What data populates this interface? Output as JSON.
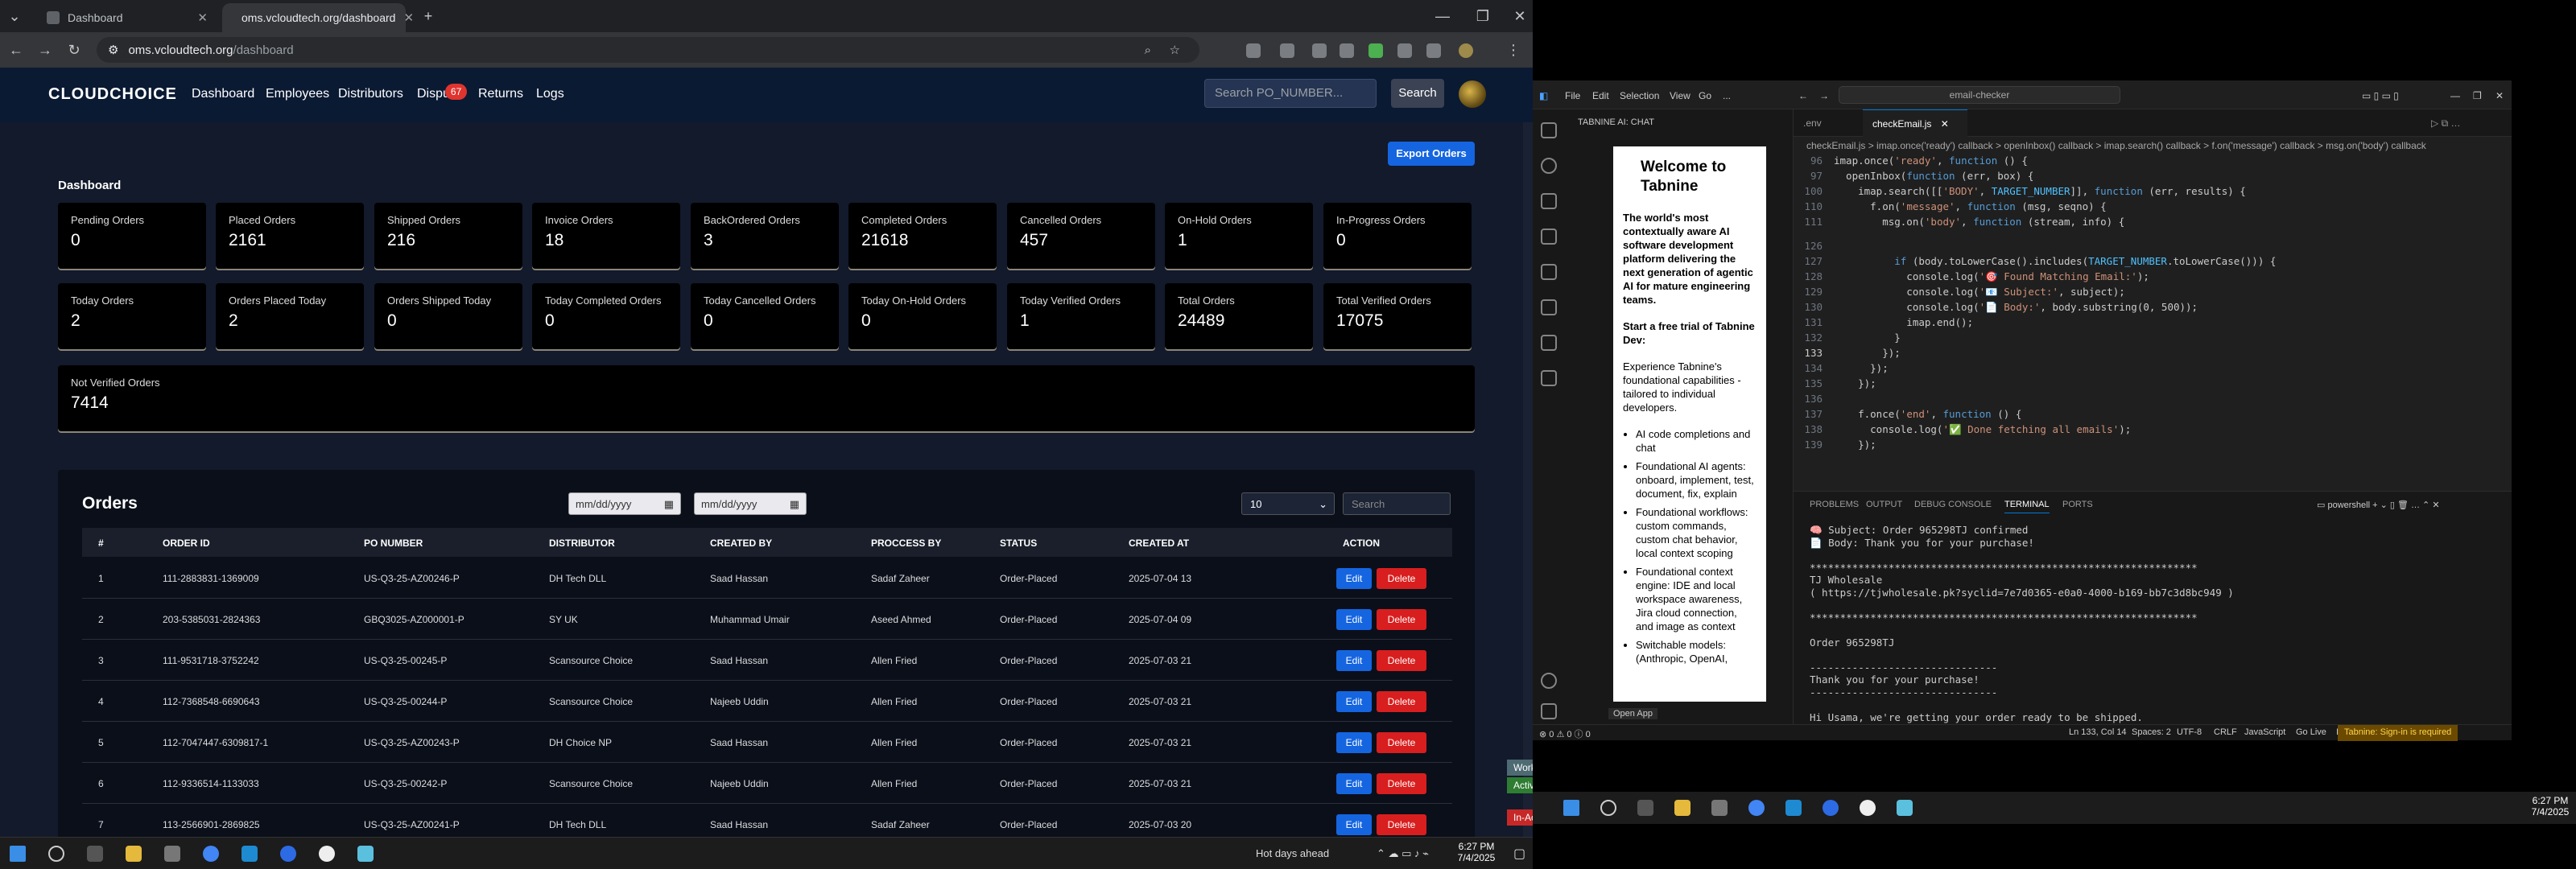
{
  "browser": {
    "tabs": [
      {
        "label": "Dashboard"
      },
      {
        "label": "oms.vcloudtech.org/dashboard"
      }
    ],
    "url_domain": "oms.vcloudtech.org",
    "url_path": "/dashboard"
  },
  "app": {
    "logo": "CLOUDCHOICE",
    "nav": [
      "Dashboard",
      "Employees",
      "Distributors",
      "Dispu",
      "Returns",
      "Logs"
    ],
    "disputes_badge": "67",
    "search_placeholder": "Search PO_NUMBER...",
    "search_button": "Search"
  },
  "dashboard": {
    "export_label": "Export Orders",
    "title": "Dashboard",
    "cards": [
      {
        "label": "Pending Orders",
        "value": "0"
      },
      {
        "label": "Placed Orders",
        "value": "2161"
      },
      {
        "label": "Shipped Orders",
        "value": "216"
      },
      {
        "label": "Invoice Orders",
        "value": "18"
      },
      {
        "label": "BackOrdered Orders",
        "value": "3"
      },
      {
        "label": "Completed Orders",
        "value": "21618"
      },
      {
        "label": "Cancelled Orders",
        "value": "457"
      },
      {
        "label": "On-Hold Orders",
        "value": "1"
      },
      {
        "label": "In-Progress Orders",
        "value": "0"
      },
      {
        "label": "Today Orders",
        "value": "2"
      },
      {
        "label": "Orders Placed Today",
        "value": "2"
      },
      {
        "label": "Orders Shipped Today",
        "value": "0"
      },
      {
        "label": "Today Completed Orders",
        "value": "0"
      },
      {
        "label": "Today Cancelled Orders",
        "value": "0"
      },
      {
        "label": "Today On-Hold Orders",
        "value": "0"
      },
      {
        "label": "Today Verified Orders",
        "value": "1"
      },
      {
        "label": "Total Orders",
        "value": "24489"
      },
      {
        "label": "Total Verified Orders",
        "value": "17075"
      },
      {
        "label": "Not Verified Orders",
        "value": "7414"
      }
    ]
  },
  "orders": {
    "title": "Orders",
    "date_placeholder": "mm/dd/yyyy",
    "page_size": "10",
    "search_placeholder": "Search",
    "columns": [
      "#",
      "ORDER ID",
      "PO NUMBER",
      "DISTRIBUTOR",
      "CREATED BY",
      "PROCCESS BY",
      "STATUS",
      "CREATED AT",
      "ACTION"
    ],
    "edit_label": "Edit",
    "delete_label": "Delete",
    "rows": [
      [
        "1",
        "111-2883831-1369009",
        "US-Q3-25-AZ00246-P",
        "DH Tech DLL",
        "Saad Hassan",
        "Sadaf Zaheer",
        "Order-Placed",
        "2025-07-04 13"
      ],
      [
        "2",
        "203-5385031-2824363",
        "GBQ3025-AZ000001-P",
        "SY UK",
        "Muhammad Umair",
        "Aseed Ahmed",
        "Order-Placed",
        "2025-07-04 09"
      ],
      [
        "3",
        "111-9531718-3752242",
        "US-Q3-25-00245-P",
        "Scansource Choice",
        "Saad Hassan",
        "Allen Fried",
        "Order-Placed",
        "2025-07-03 21"
      ],
      [
        "4",
        "112-7368548-6690643",
        "US-Q3-25-00244-P",
        "Scansource Choice",
        "Najeeb Uddin",
        "Allen Fried",
        "Order-Placed",
        "2025-07-03 21"
      ],
      [
        "5",
        "112-7047447-6309817-1",
        "US-Q3-25-AZ00243-P",
        "DH Choice NP",
        "Saad Hassan",
        "Allen Fried",
        "Order-Placed",
        "2025-07-03 21"
      ],
      [
        "6",
        "112-9336514-1133033",
        "US-Q3-25-00242-P",
        "Scansource Choice",
        "Najeeb Uddin",
        "Allen Fried",
        "Order-Placed",
        "2025-07-03 21"
      ],
      [
        "7",
        "113-2566901-2869825",
        "US-Q3-25-AZ00241-P",
        "DH Tech DLL",
        "Saad Hassan",
        "Sadaf Zaheer",
        "Order-Placed",
        "2025-07-03 20"
      ]
    ]
  },
  "taskbar": {
    "weather": "Hot days ahead",
    "time": "6:27 PM",
    "date": "7/4/2025"
  },
  "working_status": {
    "status": "Working Status: Active",
    "active": "Active",
    "inactive": "In-Acti"
  },
  "vscode": {
    "menus": [
      "File",
      "Edit",
      "Selection",
      "View",
      "Go",
      "..."
    ],
    "search": "email-checker",
    "side_header": "TABNINE AI: CHAT",
    "tabnine": {
      "title": "Welcome to Tabnine",
      "intro": "The world's most contextually aware AI software development platform delivering the next generation of agentic AI for mature engineering teams.",
      "trial": "Start a free trial of Tabnine Dev:",
      "exp": "Experience Tabnine's foundational capabilities - tailored to individual developers.",
      "bullets": [
        "AI code completions and chat",
        "Foundational AI agents: onboard, implement, test, document, fix, explain",
        "Foundational workflows: custom commands, custom chat behavior, local context scoping",
        "Foundational context engine: IDE and local workspace awareness, Jira cloud connection, and image as context",
        "Switchable models: (Anthropic, OpenAI,"
      ]
    },
    "open_app": "Open App",
    "tabs": [
      ".env",
      "checkEmail.js"
    ],
    "breadcrumb": "checkEmail.js > imap.once('ready') callback > openInbox() callback > imap.search() callback > f.on('message') callback > msg.on('body') callback",
    "code_top": [
      {
        "n": "96",
        "t": "imap.once('ready', function () {"
      },
      {
        "n": "97",
        "t": "  openInbox(function (err, box) {"
      },
      {
        "n": "100",
        "t": "    imap.search([['BODY', TARGET_NUMBER]], function (err, results) {"
      },
      {
        "n": "110",
        "t": "      f.on('message', function (msg, seqno) {"
      },
      {
        "n": "111",
        "t": "        msg.on('body', function (stream, info) {"
      }
    ],
    "code": [
      {
        "n": "126",
        "t": ""
      },
      {
        "n": "127",
        "t": "          if (body.toLowerCase().includes(TARGET_NUMBER.toLowerCase())) {"
      },
      {
        "n": "128",
        "t": "            console.log('🎯 Found Matching Email:');"
      },
      {
        "n": "129",
        "t": "            console.log('📧 Subject:', subject);"
      },
      {
        "n": "130",
        "t": "            console.log('📄 Body:', body.substring(0, 500));"
      },
      {
        "n": "131",
        "t": "            imap.end();"
      },
      {
        "n": "132",
        "t": "          }"
      },
      {
        "n": "133",
        "t": "        });"
      },
      {
        "n": "134",
        "t": "      });"
      },
      {
        "n": "135",
        "t": "    });"
      },
      {
        "n": "136",
        "t": ""
      },
      {
        "n": "137",
        "t": "    f.once('end', function () {"
      },
      {
        "n": "138",
        "t": "      console.log('✅ Done fetching all emails');"
      },
      {
        "n": "139",
        "t": "    });"
      }
    ],
    "panel_tabs": [
      "PROBLEMS",
      "OUTPUT",
      "DEBUG CONSOLE",
      "TERMINAL",
      "PORTS"
    ],
    "shell": "powershell",
    "terminal": [
      "🧠 Subject: Order 965298TJ confirmed",
      "📄 Body: Thank you for your purchase!",
      "",
      "****************************************************************",
      "TJ Wholesale",
      "( https://tjwholesale.pk?syclid=7e7d0365-e0a0-4000-b169-bb7c3d8bc949 )",
      "",
      "****************************************************************",
      "",
      "Order 965298TJ",
      "",
      "-------------------------------",
      "Thank you for your purchase!",
      "-------------------------------",
      "",
      "Hi Usama, we're getting your order ready to be shipped."
    ],
    "status_items": [
      "Ln 133, Col 14",
      "Spaces: 2",
      "UTF-8",
      "CRLF",
      "JavaScript",
      "Go Live",
      "Insert"
    ],
    "status_problems": "⊗ 0 ⚠ 0 ⓘ 0",
    "tabnine_status": "Tabnine: Sign-in is required"
  }
}
